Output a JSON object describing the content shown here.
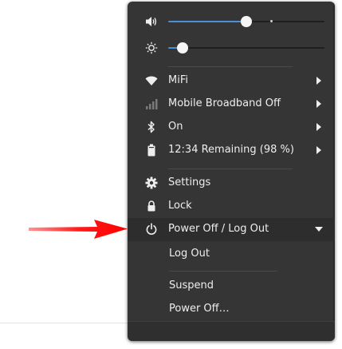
{
  "background": {
    "fragment_text": ""
  },
  "menu": {
    "volume": {
      "icon": "volume-high-icon",
      "level": 0.5,
      "tick": 0.66
    },
    "brightness": {
      "icon": "brightness-icon",
      "level": 0.09
    },
    "network_items": [
      {
        "icon": "wifi-icon",
        "label": "MiFi",
        "has_submenu": true
      },
      {
        "icon": "cellular-signal-icon",
        "label": "Mobile Broadband Off",
        "has_submenu": true
      },
      {
        "icon": "bluetooth-icon",
        "label": "On",
        "has_submenu": true
      },
      {
        "icon": "battery-icon",
        "label": "12:34 Remaining (98 %)",
        "has_submenu": true
      }
    ],
    "actions": [
      {
        "icon": "gear-icon",
        "label": "Settings"
      },
      {
        "icon": "lock-icon",
        "label": "Lock"
      }
    ],
    "power": {
      "icon": "power-icon",
      "label": "Power Off / Log Out",
      "expanded": true,
      "submenu": [
        "Log Out",
        "Suspend",
        "Power Off…"
      ]
    }
  },
  "annotation": {
    "arrow_color": "#ff0000"
  }
}
